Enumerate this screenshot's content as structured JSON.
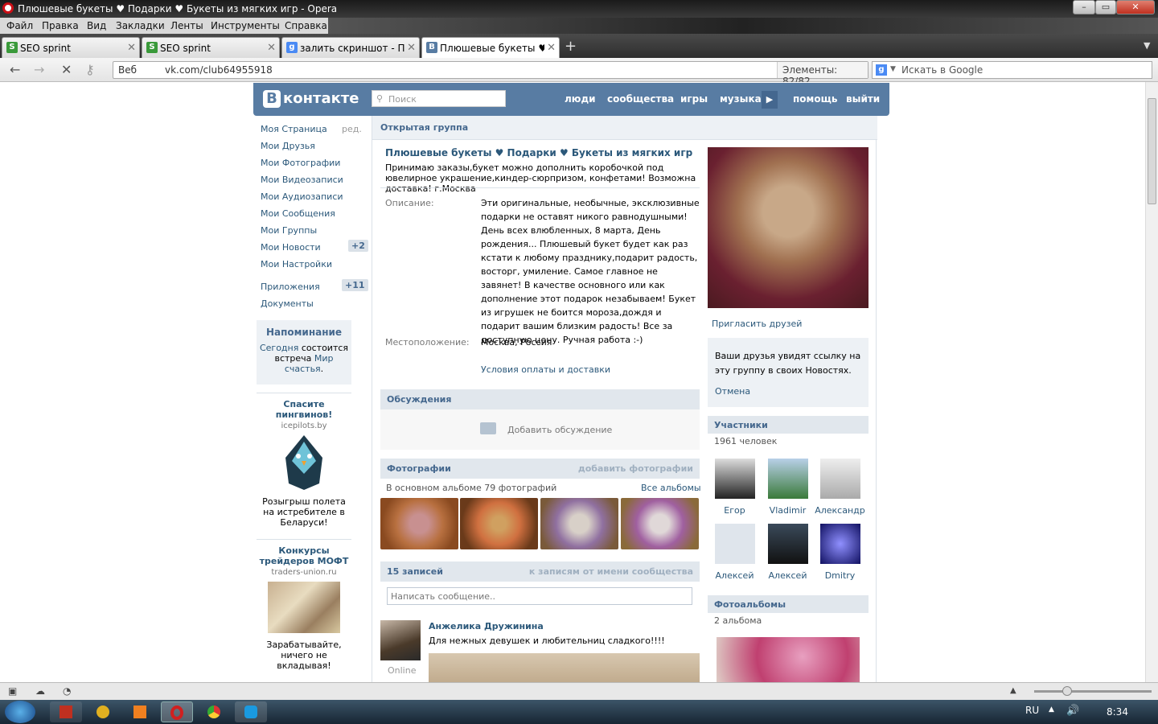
{
  "window": {
    "title": "Плюшевые букеты ♥ Подарки ♥ Букеты из мягких игр - Opera"
  },
  "menu": [
    "Файл",
    "Правка",
    "Вид",
    "Закладки",
    "Ленты",
    "Инструменты",
    "Справка"
  ],
  "tabs": [
    {
      "label": "SEO sprint"
    },
    {
      "label": "SEO sprint"
    },
    {
      "label": "залить скриншот - По..."
    },
    {
      "label": "Плюшевые букеты ♥ ..."
    }
  ],
  "address": {
    "badge": "Веб",
    "url": "vk.com/club64955918",
    "counter": "Элементы:  82/82"
  },
  "search": {
    "placeholder": "Искать в Google"
  },
  "vk": {
    "logo": "контакте",
    "search_placeholder": "Поиск",
    "nav": [
      "люди",
      "сообщества",
      "игры",
      "музыка",
      "помощь",
      "выйти"
    ]
  },
  "left": {
    "items": [
      "Моя Страница",
      "Мои Друзья",
      "Мои Фотографии",
      "Мои Видеозаписи",
      "Мои Аудиозаписи",
      "Мои Сообщения",
      "Мои Группы",
      "Мои Новости",
      "Мои Настройки"
    ],
    "edit": "ред.",
    "news_badge": "+2",
    "apps": "Приложения",
    "apps_badge": "+11",
    "docs": "Документы",
    "reminder_title": "Напоминание",
    "reminder_link1": "Сегодня",
    "reminder_text": "состоится встреча",
    "reminder_link2": "Мир счастья",
    "ad1_title": "Спасите пингвинов!",
    "ad1_domain": "icepilots.by",
    "ad1_text": "Розыгрыш полета на истребителе в Беларуси!",
    "ad2_title": "Конкурсы трейдеров МОФТ",
    "ad2_domain": "traders-union.ru",
    "ad2_text": "Зарабатывайте, ничего не вкладывая!"
  },
  "group": {
    "type": "Открытая группа",
    "name": "Плюшевые букеты ♥ Подарки ♥ Букеты из мягких игр",
    "status": "Принимаю заказы,букет можно дополнить коробочкой под ювелирное украшение,киндер-сюрпризом, конфетами! Возможна доставка! г.Москва",
    "desc_label": "Описание:",
    "desc": "Эти оригинальные, необычные, эксклюзивные подарки не оставят никого равнодушными! День всех влюбленных, 8 марта, День рождения... Плюшевый букет будет как раз кстати к любому празднику,подарит радость, восторг, умиление. Самое главное не завянет! В качестве основного или как дополнение этот подарок незабываем! Букет из игрушек не боится мороза,дождя и подарит вашим близким радость! Все за доступную цену. Ручная работа :-)",
    "loc_label": "Местоположение:",
    "loc": "Москва, Россия",
    "link": "Условия оплаты и доставки"
  },
  "discussions": {
    "title": "Обсуждения",
    "add": "Добавить обсуждение"
  },
  "photos": {
    "title": "Фотографии",
    "add": "добавить фотографии",
    "count": "В основном альбоме 79 фотографий",
    "all": "Все альбомы"
  },
  "wall": {
    "title": "15 записей",
    "link": "к записям от имени сообщества",
    "placeholder": "Написать сообщение..",
    "author": "Анжелика Дружинина",
    "text": "Для нежных девушек и любительниц сладкого!!!!",
    "online": "Online"
  },
  "right": {
    "invite": "Пригласить друзей",
    "info": "Ваши друзья увидят ссылку на эту группу в своих Новостях.",
    "cancel": "Отмена",
    "members_title": "Участники",
    "members_count": "1961 человек",
    "members": [
      "Егор",
      "Vladimir",
      "Александр",
      "Алексей",
      "Алексей",
      "Dmitry"
    ],
    "albums_title": "Фотоальбомы",
    "albums_count": "2 альбома"
  },
  "taskbar": {
    "lang": "RU",
    "time": "8:34"
  },
  "colors": {
    "vk_blue": "#587ca3",
    "link": "#2b587a",
    "section": "#e1e7ed"
  }
}
